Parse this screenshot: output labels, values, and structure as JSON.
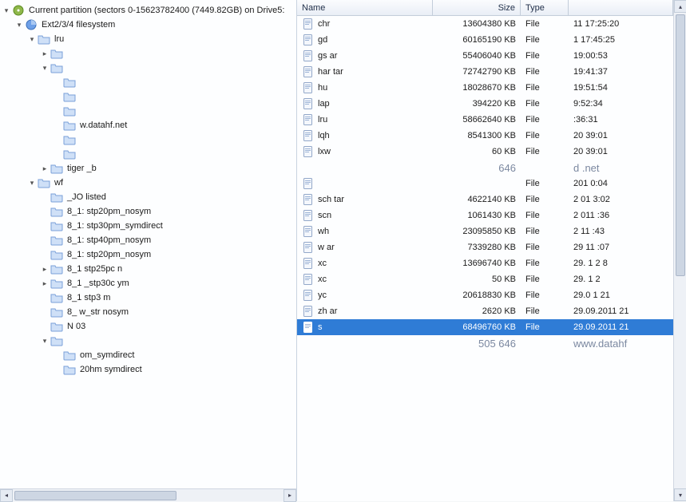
{
  "tree": {
    "root_label": "Current partition (sectors 0-15623782400 (7449.82GB) on Drive5:",
    "ext_label": "Ext2/3/4 filesystem",
    "items": [
      "lru",
      "",
      "",
      "",
      "",
      "",
      "w.datahf.net",
      "",
      "",
      "tiger     _b",
      "wf",
      "_JO      listed",
      "8_1:      stp20pm_nosym",
      "8_1:      stp30pm_symdirect",
      "8_1:      stp40pm_nosym",
      "8_1:      stp20pm_nosym",
      "8_1      stp25pc     n",
      "8_1     _stp30c     ym",
      "8_1       stp3      m",
      "8_      w_str      nosym",
      "N       03",
      "",
      "om_symdirect",
      "20hm  symdirect"
    ]
  },
  "columns": {
    "name": "Name",
    "size": "Size",
    "type": "Type",
    "date": ""
  },
  "colw": {
    "name": 170,
    "size": 110,
    "type": 60,
    "date": 130
  },
  "rows": [
    {
      "name": "chr",
      "size": "13604380 KB",
      "type": "File",
      "date": "11 17:25:20"
    },
    {
      "name": "gd",
      "size": "60165190 KB",
      "type": "File",
      "date": "1 17:45:25"
    },
    {
      "name": "gs       ar",
      "size": "55406040 KB",
      "type": "File",
      "date": "19:00:53"
    },
    {
      "name": "har      tar",
      "size": "72742790 KB",
      "type": "File",
      "date": "19:41:37"
    },
    {
      "name": "hu",
      "size": "18028670 KB",
      "type": "File",
      "date": "19:51:54"
    },
    {
      "name": "lap",
      "size": "394220 KB",
      "type": "File",
      "date": "9:52:34"
    },
    {
      "name": "lru",
      "size": "58662640 KB",
      "type": "File",
      "date": "    :36:31"
    },
    {
      "name": "lqh",
      "size": "8541300 KB",
      "type": "File",
      "date": "20    39:01"
    },
    {
      "name": "lxw",
      "size": "60 KB",
      "type": "File",
      "date": "20    39:01"
    },
    {
      "name": "",
      "size": "646",
      "type": "",
      "date": "d      .net",
      "wm": true
    },
    {
      "name": "",
      "size": "",
      "type": "File",
      "date": "201   0:04"
    },
    {
      "name": "sch     tar",
      "size": "4622140 KB",
      "type": "File",
      "date": "2    01   3:02"
    },
    {
      "name": "scn",
      "size": "1061430 KB",
      "type": "File",
      "date": "2    011    :36"
    },
    {
      "name": "wh",
      "size": "23095850 KB",
      "type": "File",
      "date": "2     11    :43"
    },
    {
      "name": "w       ar",
      "size": "7339280 KB",
      "type": "File",
      "date": "29   11     :07"
    },
    {
      "name": "xc",
      "size": "13696740 KB",
      "type": "File",
      "date": "29.    1 2   8"
    },
    {
      "name": "xc",
      "size": "50 KB",
      "type": "File",
      "date": "29.    1 2"
    },
    {
      "name": "yc",
      "size": "20618830 KB",
      "type": "File",
      "date": "29.0    1 21"
    },
    {
      "name": "zh      ar",
      "size": "2620 KB",
      "type": "File",
      "date": "29.09.2011 21"
    },
    {
      "name": "s",
      "size": "68496760 KB",
      "type": "File",
      "date": "29.09.2011 21",
      "sel": true
    },
    {
      "name": "",
      "size": "505 646",
      "type": "",
      "date": "www.datahf",
      "wm": true
    }
  ],
  "icons": {
    "expand_open": "▾",
    "expand_closed": "▸",
    "scroll_left": "◂",
    "scroll_right": "▸",
    "scroll_up": "▴",
    "scroll_down": "▾"
  }
}
